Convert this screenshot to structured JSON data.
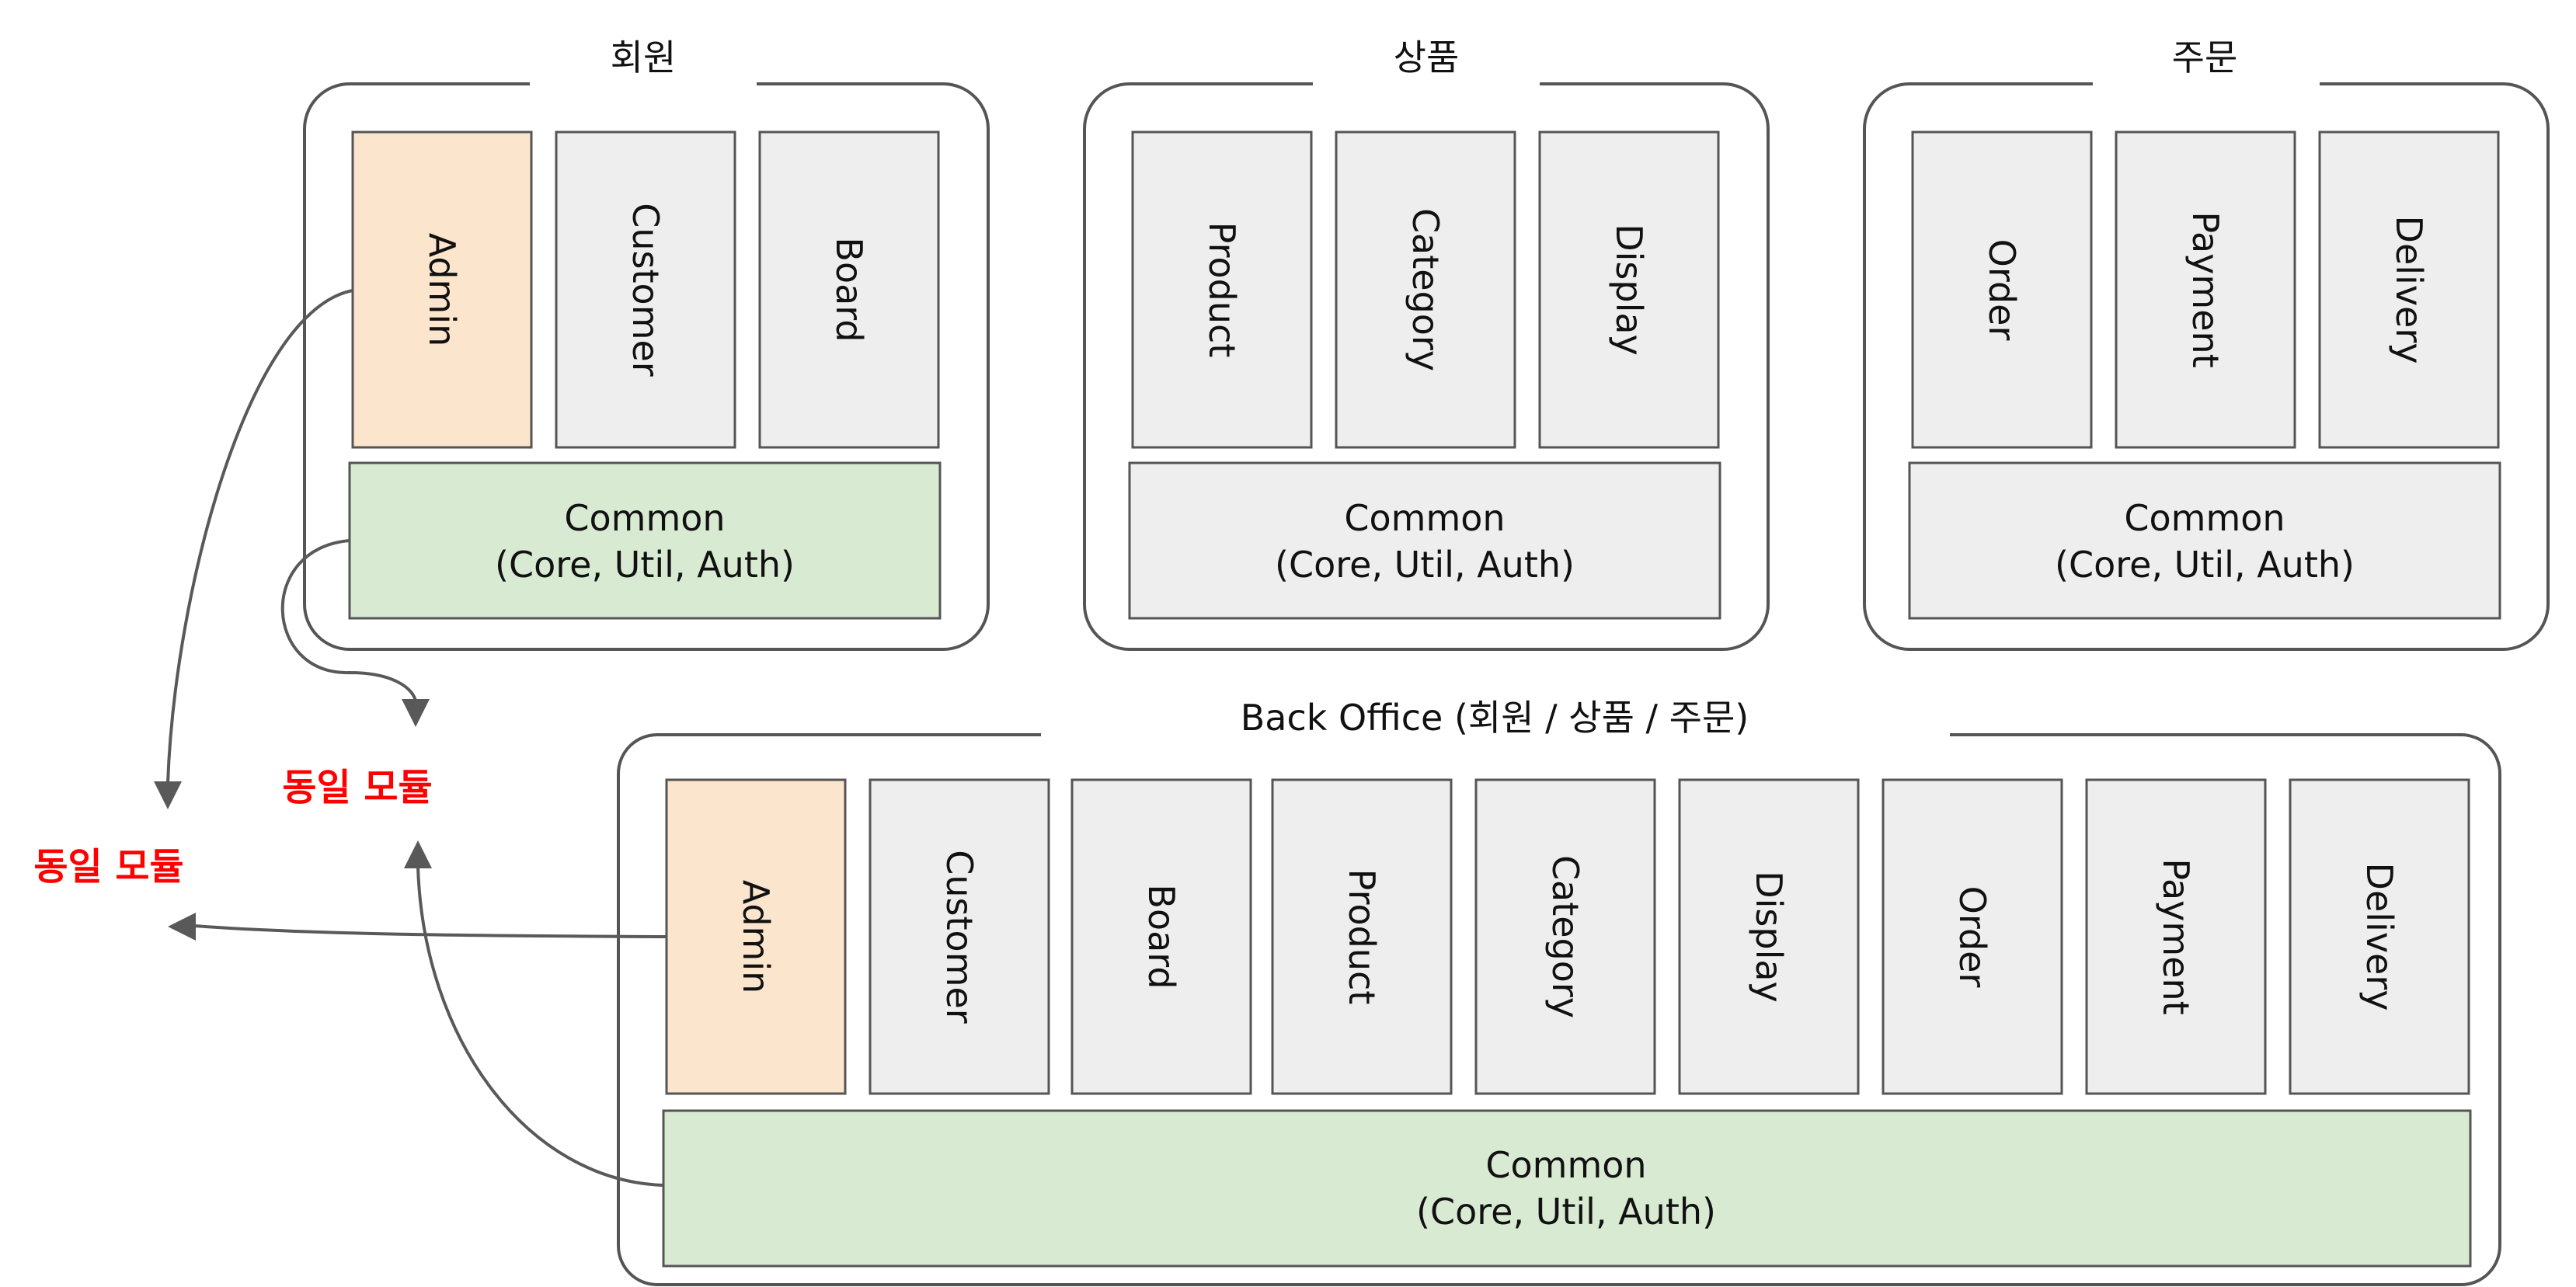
{
  "groups": {
    "member": {
      "title": "회원",
      "modules": [
        "Admin",
        "Customer",
        "Board"
      ],
      "common": [
        "Common",
        "(Core, Util, Auth)"
      ]
    },
    "product": {
      "title": "상품",
      "modules": [
        "Product",
        "Category",
        "Display"
      ],
      "common": [
        "Common",
        "(Core, Util, Auth)"
      ]
    },
    "order": {
      "title": "주문",
      "modules": [
        "Order",
        "Payment",
        "Delivery"
      ],
      "common": [
        "Common",
        "(Core, Util, Auth)"
      ]
    },
    "backoffice": {
      "title": "Back Office (회원 / 상품 / 주문)",
      "modules": [
        "Admin",
        "Customer",
        "Board",
        "Product",
        "Category",
        "Display",
        "Order",
        "Payment",
        "Delivery"
      ],
      "common": [
        "Common",
        "(Core, Util, Auth)"
      ]
    }
  },
  "annotations": {
    "same_module_common": "동일 모듈",
    "same_module_admin": "동일 모듈"
  },
  "colors": {
    "highlight_module": "#fbe5cd",
    "shared_common": "#d9ead3",
    "default_module": "#eeeeee",
    "annotation_text": "#ff0000",
    "arrow": "#595959",
    "border": "#555555"
  }
}
